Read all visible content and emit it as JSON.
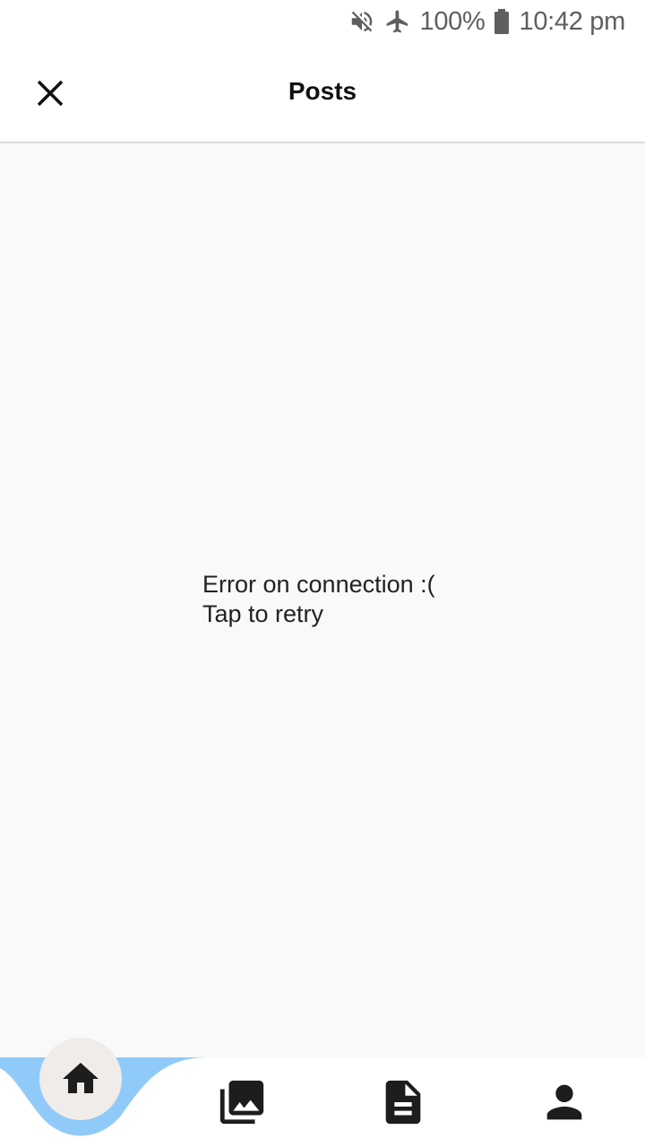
{
  "status_bar": {
    "battery_percent": "100%",
    "time": "10:42 pm",
    "icons": [
      "mute-icon",
      "airplane-mode-icon",
      "battery-icon"
    ]
  },
  "app_bar": {
    "title": "Posts",
    "close_icon": "close-icon"
  },
  "content": {
    "error_line1": "Error on connection :(",
    "error_line2": "Tap to retry"
  },
  "bottom_nav": {
    "accent_color": "#90caf9",
    "items": [
      {
        "icon": "home-icon",
        "active": true
      },
      {
        "icon": "photo-library-icon",
        "active": false
      },
      {
        "icon": "document-icon",
        "active": false
      },
      {
        "icon": "person-icon",
        "active": false
      }
    ]
  }
}
